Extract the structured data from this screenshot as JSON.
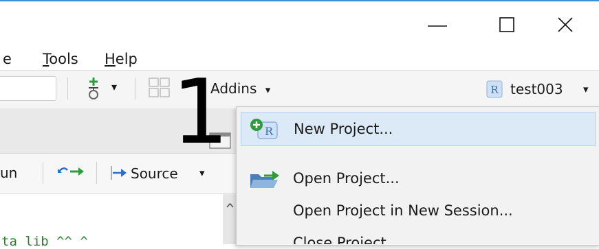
{
  "window": {
    "controls": {
      "minimize": "—",
      "maximize": "☐",
      "close": "✕"
    },
    "accent_color": "#3a8fd6"
  },
  "menubar": {
    "items": [
      {
        "label_prefix": "",
        "underline": "",
        "label_rest": "e"
      },
      {
        "label_prefix": "",
        "underline": "T",
        "label_rest": "ools"
      },
      {
        "label_prefix": "",
        "underline": "H",
        "label_rest": "elp"
      }
    ]
  },
  "toolbar": {
    "addins_label": "Addins",
    "addins_caret": "▾",
    "project_label": "test003",
    "project_caret": "▾",
    "vcs_caret": "▾"
  },
  "editor_toolbar": {
    "run_label": "un",
    "source_label": "Source",
    "source_caret": "▾"
  },
  "annotation": {
    "step_number": "1"
  },
  "dropdown": {
    "items": [
      {
        "label": "New Project...",
        "icon": "new-project-icon",
        "highlighted": true
      },
      {
        "label": "Open Project...",
        "icon": "open-project-icon",
        "highlighted": false
      },
      {
        "label": "Open Project in New Session...",
        "icon": "",
        "highlighted": false
      },
      {
        "label": "Close Project",
        "icon": "",
        "highlighted": false
      }
    ],
    "highlight_color": "#dce9f7"
  },
  "editor": {
    "partial_code_text": "ta lib ^^ ^"
  }
}
